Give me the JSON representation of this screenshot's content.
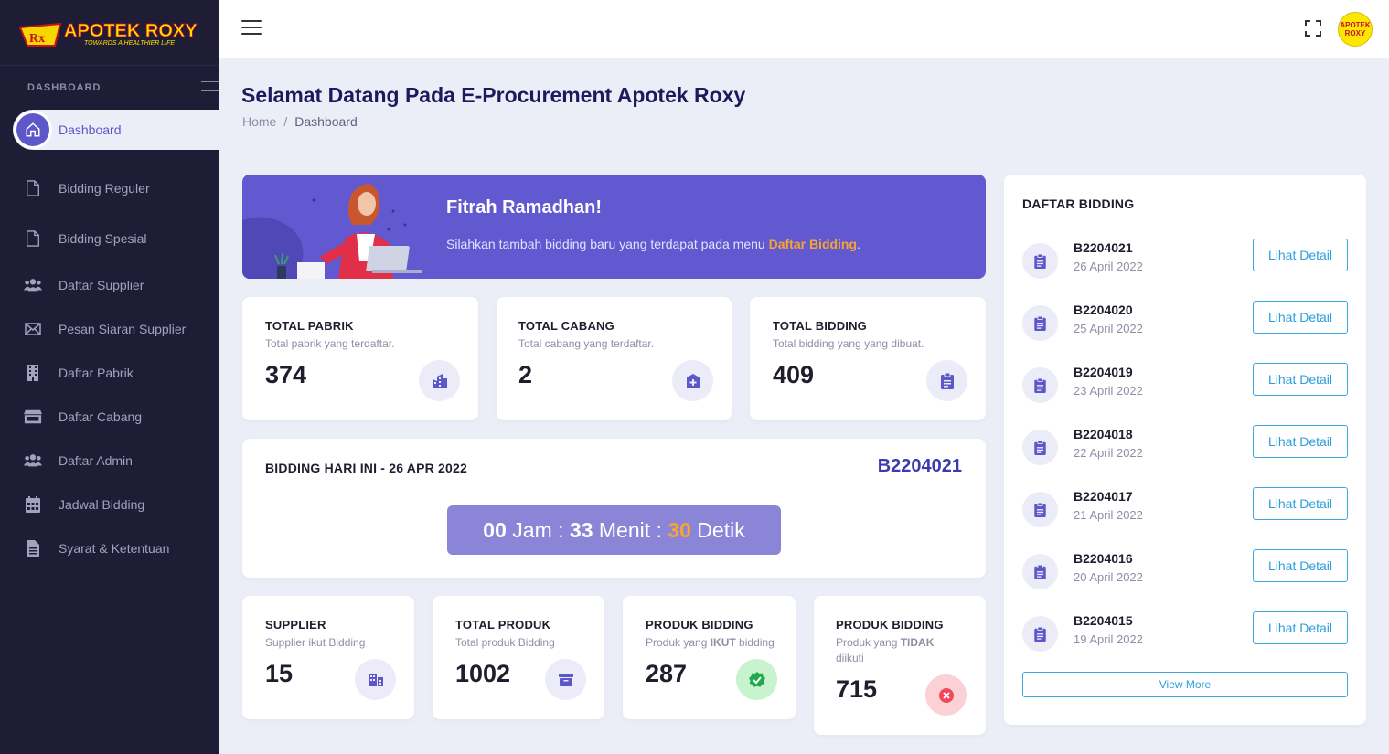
{
  "brand": {
    "name": "APOTEK ROXY",
    "tagline": "TOWARDS A HEALTHIER LIFE",
    "avatar_line1": "APOTEK",
    "avatar_line2": "ROXY"
  },
  "sidebar": {
    "section": "DASHBOARD",
    "items": [
      {
        "label": "Dashboard",
        "icon": "home-icon"
      },
      {
        "label": "Bidding Reguler",
        "icon": "file-icon"
      },
      {
        "label": "Bidding Spesial",
        "icon": "file-icon"
      },
      {
        "label": "Daftar Supplier",
        "icon": "users-icon"
      },
      {
        "label": "Pesan Siaran Supplier",
        "icon": "envelope-icon"
      },
      {
        "label": "Daftar Pabrik",
        "icon": "building-icon"
      },
      {
        "label": "Daftar Cabang",
        "icon": "store-icon"
      },
      {
        "label": "Daftar Admin",
        "icon": "users-icon"
      },
      {
        "label": "Jadwal Bidding",
        "icon": "calendar-icon"
      },
      {
        "label": "Syarat & Ketentuan",
        "icon": "document-icon"
      }
    ]
  },
  "header": {
    "title": "Selamat Datang Pada E-Procurement Apotek Roxy",
    "breadcrumb": [
      "Home",
      "Dashboard"
    ],
    "breadcrumb_sep": "/"
  },
  "banner": {
    "title": "Fitrah Ramadhan!",
    "text_before": "Silahkan tambah bidding baru yang terdapat pada menu ",
    "highlight": "Daftar Bidding",
    "text_after": "."
  },
  "stats_top": [
    {
      "title": "TOTAL PABRIK",
      "subtitle": "Total pabrik yang terdaftar.",
      "value": "374"
    },
    {
      "title": "TOTAL CABANG",
      "subtitle": "Total cabang yang terdaftar.",
      "value": "2"
    },
    {
      "title": "TOTAL BIDDING",
      "subtitle": "Total bidding yang yang dibuat.",
      "value": "409"
    }
  ],
  "today": {
    "title": "BIDDING HARI INI - 26 APR 2022",
    "code": "B2204021",
    "hours": "00",
    "hours_label": "Jam",
    "minutes": "33",
    "minutes_label": "Menit",
    "seconds": "30",
    "seconds_label": "Detik",
    "sep": ":"
  },
  "stats_bottom": [
    {
      "title": "SUPPLIER",
      "subtitle": "Supplier ikut Bidding",
      "value": "15"
    },
    {
      "title": "TOTAL PRODUK",
      "subtitle": "Total produk Bidding",
      "value": "1002"
    },
    {
      "title": "PRODUK BIDDING",
      "sub_before": "Produk yang ",
      "sub_bold": "IKUT",
      "sub_after": " bidding",
      "value": "287"
    },
    {
      "title": "PRODUK BIDDING",
      "sub_before": "Produk yang ",
      "sub_bold": "TIDAK",
      "sub_after": " diikuti",
      "value": "715"
    }
  ],
  "bidding_list": {
    "title": "DAFTAR BIDDING",
    "button_label": "Lihat Detail",
    "view_more": "View More",
    "items": [
      {
        "code": "B2204021",
        "date": "26 April 2022"
      },
      {
        "code": "B2204020",
        "date": "25 April 2022"
      },
      {
        "code": "B2204019",
        "date": "23 April 2022"
      },
      {
        "code": "B2204018",
        "date": "22 April 2022"
      },
      {
        "code": "B2204017",
        "date": "21 April 2022"
      },
      {
        "code": "B2204016",
        "date": "20 April 2022"
      },
      {
        "code": "B2204015",
        "date": "19 April 2022"
      }
    ]
  },
  "colors": {
    "sidebar": "#1f1d36",
    "accent": "#5d57c9",
    "orange": "#f7a431",
    "link": "#2b9fd9"
  }
}
